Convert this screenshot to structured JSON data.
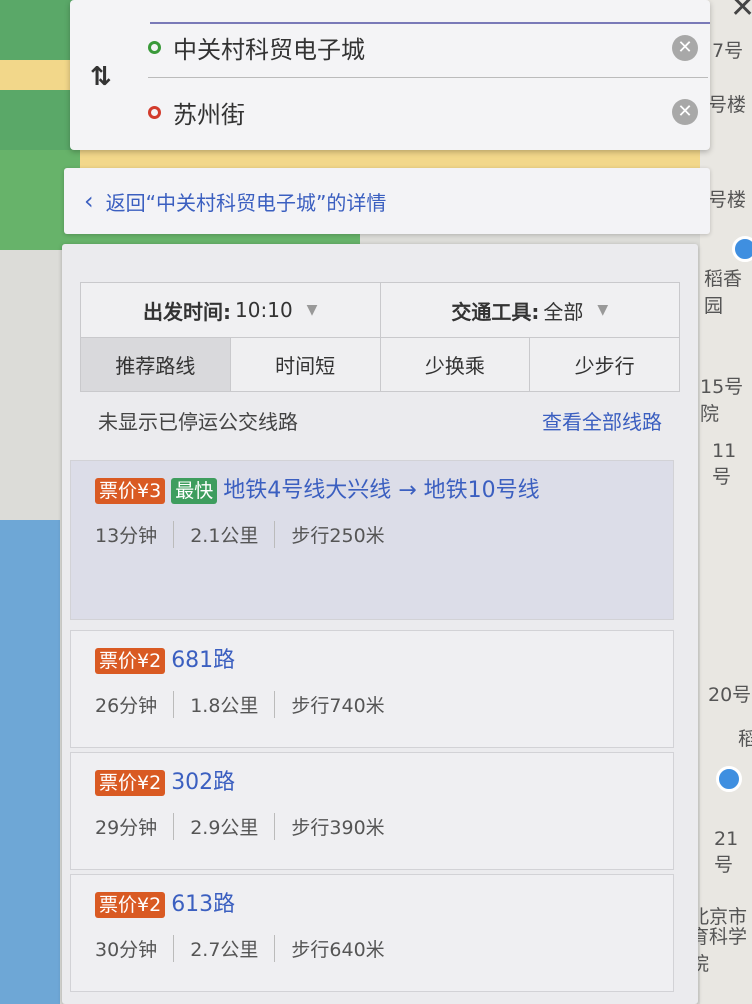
{
  "search": {
    "start": "中关村科贸电子城",
    "end": "苏州街"
  },
  "back_bar": {
    "label": "返回“中关村科贸电子城”的详情"
  },
  "filters": {
    "depart_label": "出发时间:",
    "depart_value": "10:10",
    "vehicle_label": "交通工具:",
    "vehicle_value": "全部"
  },
  "tabs": [
    {
      "label": "推荐路线",
      "active": true
    },
    {
      "label": "时间短",
      "active": false
    },
    {
      "label": "少换乘",
      "active": false
    },
    {
      "label": "少步行",
      "active": false
    }
  ],
  "notice": {
    "text": "未显示已停运公交线路",
    "view_all": "查看全部线路"
  },
  "routes": [
    {
      "fare": "票价¥3",
      "tag": "最快",
      "name": "地铁4号线大兴线 → 地铁10号线",
      "duration": "13分钟",
      "distance": "2.1公里",
      "walk": "步行250米"
    },
    {
      "fare": "票价¥2",
      "name": "681路",
      "duration": "26分钟",
      "distance": "1.8公里",
      "walk": "步行740米"
    },
    {
      "fare": "票价¥2",
      "name": "302路",
      "duration": "29分钟",
      "distance": "2.9公里",
      "walk": "步行390米"
    },
    {
      "fare": "票价¥2",
      "name": "613路",
      "duration": "30分钟",
      "distance": "2.7公里",
      "walk": "步行640米"
    }
  ],
  "map_labels": [
    "7号",
    "号楼",
    "号楼",
    "稻香园",
    "15号院",
    "11号",
    "20号",
    "稻",
    "21号",
    "北京市",
    "育科学院"
  ],
  "colors": {
    "link": "#3b5fc0",
    "fare_badge": "#d95a23",
    "fast_badge": "#3e9d5e"
  }
}
